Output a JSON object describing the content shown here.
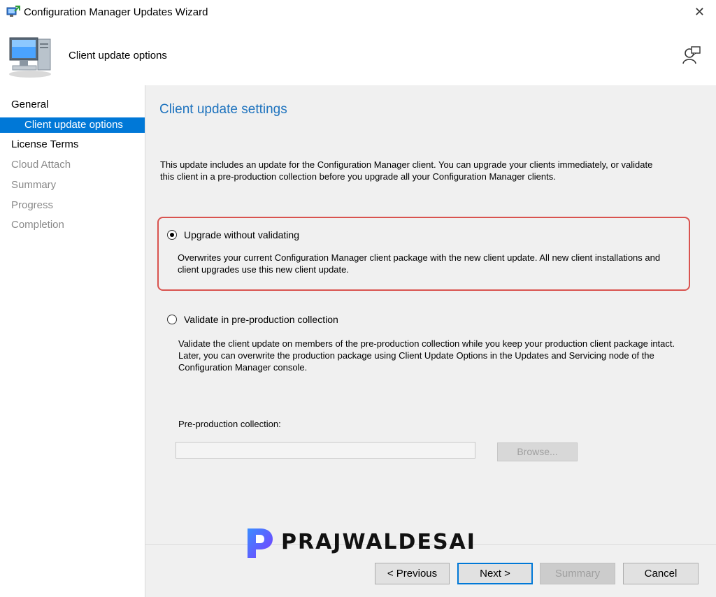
{
  "window": {
    "title": "Configuration Manager Updates Wizard",
    "close_icon": "close-icon"
  },
  "header": {
    "title": "Client update options",
    "icon": "computer-icon",
    "help_icon": "help-user-icon"
  },
  "sidebar": {
    "items": [
      {
        "label": "General",
        "state": "active"
      },
      {
        "label": "Client update options",
        "state": "selected"
      },
      {
        "label": "License Terms",
        "state": "active"
      },
      {
        "label": "Cloud Attach",
        "state": "disabled"
      },
      {
        "label": "Summary",
        "state": "disabled"
      },
      {
        "label": "Progress",
        "state": "disabled"
      },
      {
        "label": "Completion",
        "state": "disabled"
      }
    ]
  },
  "main": {
    "title": "Client update settings",
    "description": "This update includes an update for the Configuration Manager client. You can upgrade your clients immediately, or validate this client in a pre-production collection before you upgrade all your Configuration Manager clients.",
    "option1": {
      "label": "Upgrade without validating",
      "checked": true,
      "description": "Overwrites your current Configuration Manager client package with the new client update. All new client installations and client upgrades use this new client update."
    },
    "option2": {
      "label": "Validate in pre-production collection",
      "checked": false,
      "description": "Validate the client update on members of the pre-production collection while you keep your production client package intact. Later, you can overwrite the production package using Client Update Options in the Updates and Servicing node of the Configuration Manager console."
    },
    "collection_label": "Pre-production collection:",
    "collection_value": "",
    "browse_label": "Browse..."
  },
  "footer": {
    "previous": "< Previous",
    "next": "Next >",
    "summary": "Summary",
    "cancel": "Cancel"
  },
  "watermark": {
    "text": "PRAJWALDESAI"
  },
  "colors": {
    "accent": "#0078d7",
    "title_blue": "#1e73be",
    "highlight_red": "#d9534f",
    "panel_bg": "#f0f0f0"
  }
}
